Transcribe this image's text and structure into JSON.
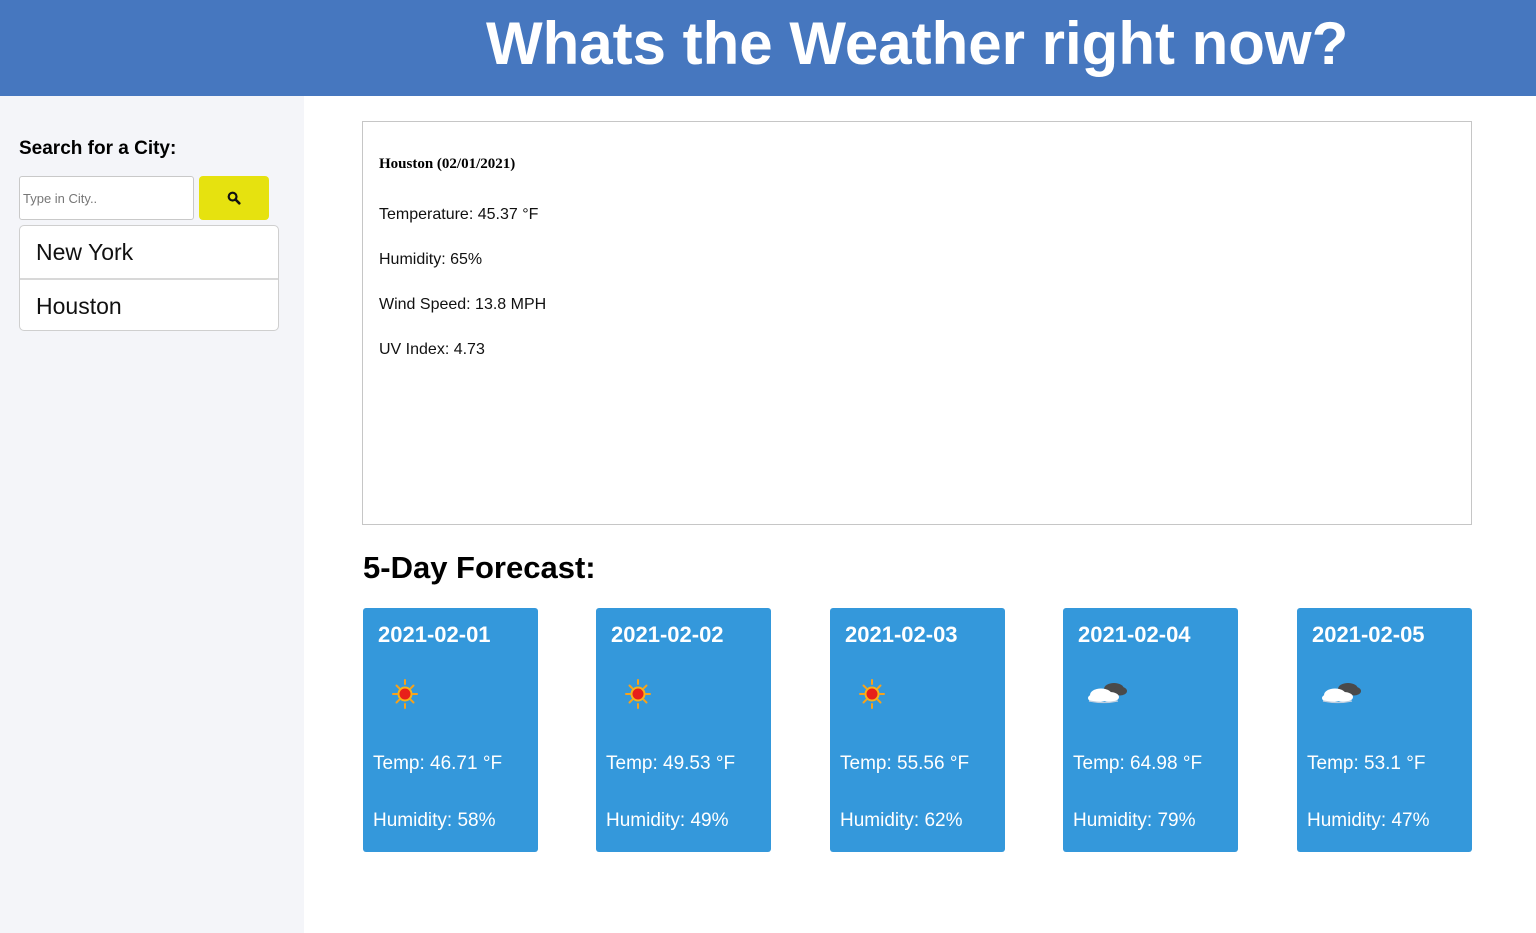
{
  "header": {
    "title": "Whats the Weather right now?"
  },
  "sidebar": {
    "search_label": "Search for a City:",
    "search_placeholder": "Type in City..",
    "search_value": "",
    "search_button_icon": "search-icon",
    "cities": [
      "New York",
      "Houston"
    ]
  },
  "current": {
    "title": "Houston (02/01/2021)",
    "temperature": "Temperature: 45.37 °F",
    "humidity": "Humidity: 65%",
    "wind_speed": "Wind Speed: 13.8 MPH",
    "uv_index": "UV Index: 4.73"
  },
  "forecast": {
    "heading": "5-Day Forecast:",
    "days": [
      {
        "date": "2021-02-01",
        "icon": "sun-icon",
        "temp": "Temp: 46.71 °F",
        "humidity": "Humidity: 58%"
      },
      {
        "date": "2021-02-02",
        "icon": "sun-icon",
        "temp": "Temp: 49.53 °F",
        "humidity": "Humidity: 49%"
      },
      {
        "date": "2021-02-03",
        "icon": "sun-icon",
        "temp": "Temp: 55.56 °F",
        "humidity": "Humidity: 62%"
      },
      {
        "date": "2021-02-04",
        "icon": "cloud-icon",
        "temp": "Temp: 64.98 °F",
        "humidity": "Humidity: 79%"
      },
      {
        "date": "2021-02-05",
        "icon": "cloud-icon",
        "temp": "Temp: 53.1 °F",
        "humidity": "Humidity: 47%"
      }
    ]
  },
  "colors": {
    "header_bg": "#4677bf",
    "sidebar_bg": "#f4f5f9",
    "search_button": "#e6e20f",
    "card_bg": "#3498db"
  }
}
